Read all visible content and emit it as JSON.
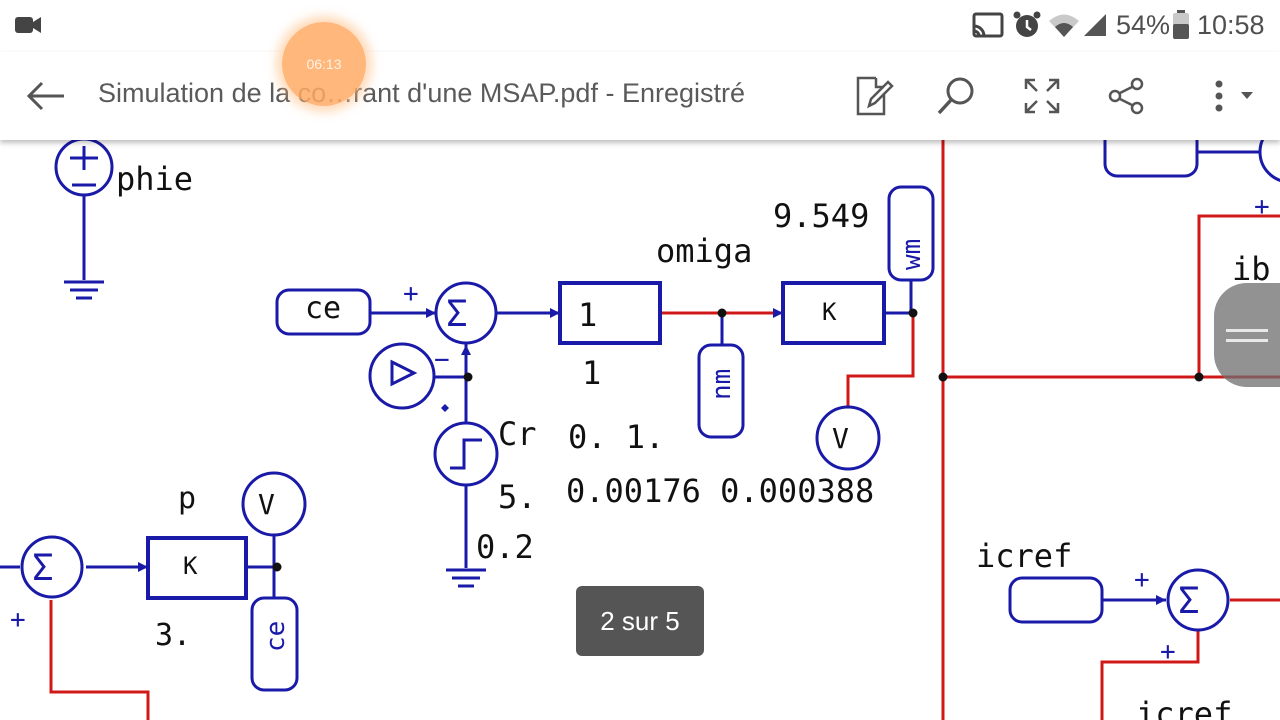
{
  "status_bar": {
    "battery_percent": "54%",
    "time": "10:58"
  },
  "recording_timer": "06:13",
  "toolbar": {
    "title": "Simulation de la co…rant d'une MSAP.pdf - Enregistré",
    "icons": [
      "back-arrow-icon",
      "edit-document-icon",
      "search-icon",
      "fullscreen-icon",
      "share-icon",
      "more-options-icon"
    ]
  },
  "page_indicator": "2 sur 5",
  "schematic": {
    "labels": {
      "phie": "phie",
      "ce": "ce",
      "one_block": "1",
      "one_below": "1",
      "omiga": "omiga",
      "gain_main": "9.549",
      "k": "K",
      "wm": "wm",
      "nm": "nm",
      "v": "V",
      "cr": "Cr",
      "step_vals": "0. 1.",
      "five": "5.",
      "params": "0.00176 0.000388",
      "step_low": "0.2",
      "p": "p",
      "three": "3.",
      "ce_meter": "ce",
      "icref": "icref",
      "icref2": "icref",
      "ib": "ib",
      "plus": "+",
      "minus": "−",
      "sigma": "Σ"
    },
    "colors": {
      "wire_blue": "#1a1aa8",
      "wire_red": "#d01818",
      "text": "#111111"
    }
  }
}
